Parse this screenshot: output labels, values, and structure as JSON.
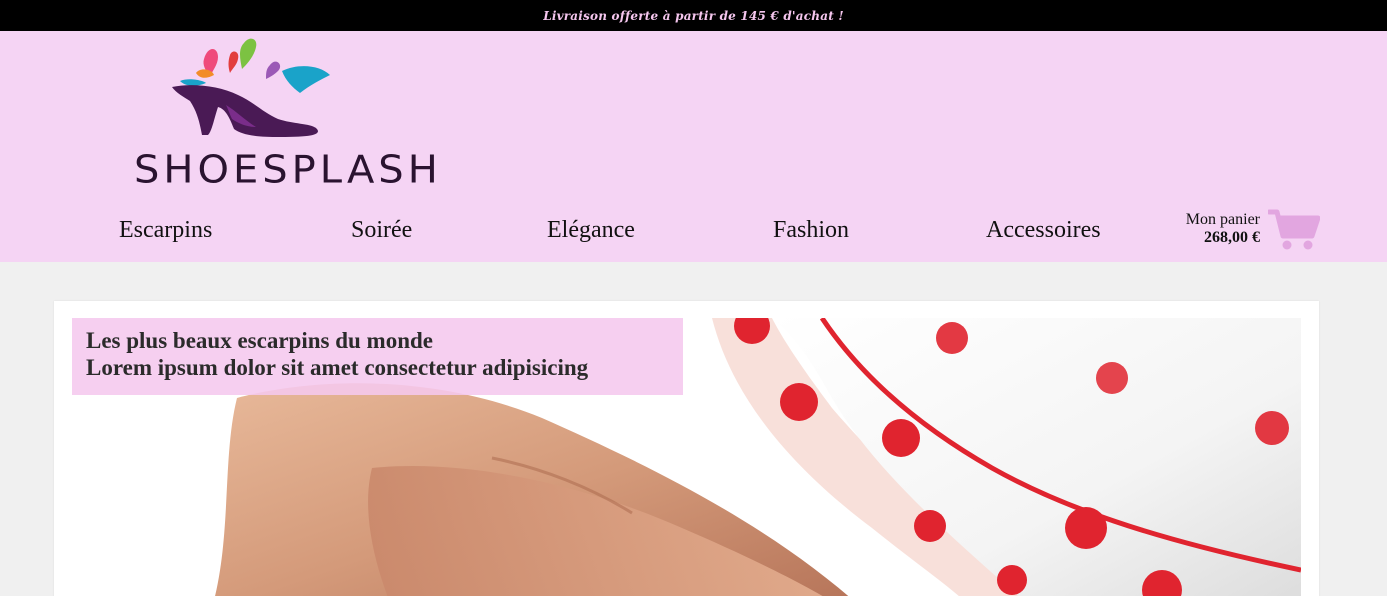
{
  "topbar": {
    "promo": "Livraison offerte à partir de 145 € d'achat !"
  },
  "brand": {
    "name": "SHOESPLASH"
  },
  "nav": {
    "items": [
      {
        "label": "Escarpins"
      },
      {
        "label": "Soirée"
      },
      {
        "label": "Elégance"
      },
      {
        "label": "Fashion"
      },
      {
        "label": "Accessoires"
      }
    ]
  },
  "cart": {
    "label": "Mon panier",
    "total": "268,00 €",
    "icon": "shopping-cart-icon"
  },
  "hero": {
    "title_line1": "Les plus beaux escarpins du monde",
    "title_line2": "Lorem ipsum dolor sit amet consectetur adipisicing"
  },
  "colors": {
    "header_bg": "#f5d4f4",
    "topbar_bg": "#000000",
    "topbar_text": "#f5c6ee",
    "cart_icon": "#e2a6e0",
    "caption_bg": "#f5c8ee"
  }
}
